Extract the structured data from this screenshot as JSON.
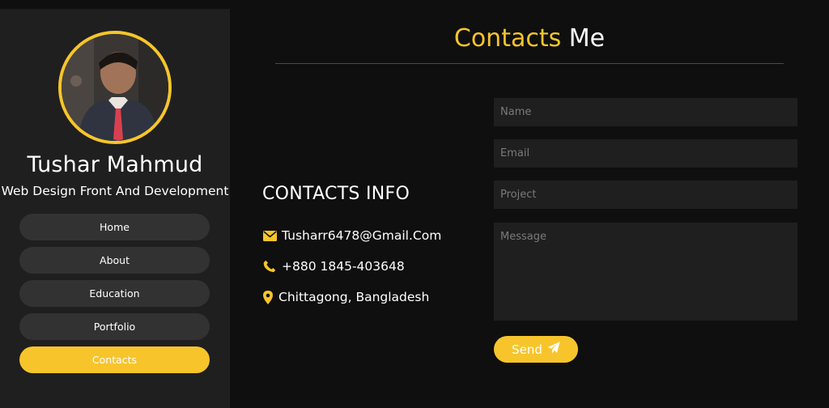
{
  "profile": {
    "name": "Tushar Mahmud",
    "role": "Web Design Front And Development",
    "avatar_icon": "profile-photo"
  },
  "nav": {
    "items": [
      {
        "label": "Home",
        "active": false
      },
      {
        "label": "About",
        "active": false
      },
      {
        "label": "Education",
        "active": false
      },
      {
        "label": "Portfolio",
        "active": false
      },
      {
        "label": "Contacts",
        "active": true
      }
    ]
  },
  "header": {
    "title_accent": "Contacts",
    "title_rest": " Me"
  },
  "contact_info": {
    "heading": "CONTACTS INFO",
    "email": "Tusharr6478@Gmail.Com",
    "phone": "+880 1845-403648",
    "address": "Chittagong, Bangladesh",
    "icons": [
      "envelope-icon",
      "phone-icon",
      "map-pin-icon"
    ]
  },
  "form": {
    "name_placeholder": "Name",
    "email_placeholder": "Email",
    "project_placeholder": "Project",
    "message_placeholder": "Message",
    "send_label": "Send",
    "send_icon": "paper-plane-icon"
  },
  "colors": {
    "accent": "#f7c52b",
    "background": "#0f0f0f",
    "sidebar": "#1f1f1f",
    "button": "#323232"
  }
}
